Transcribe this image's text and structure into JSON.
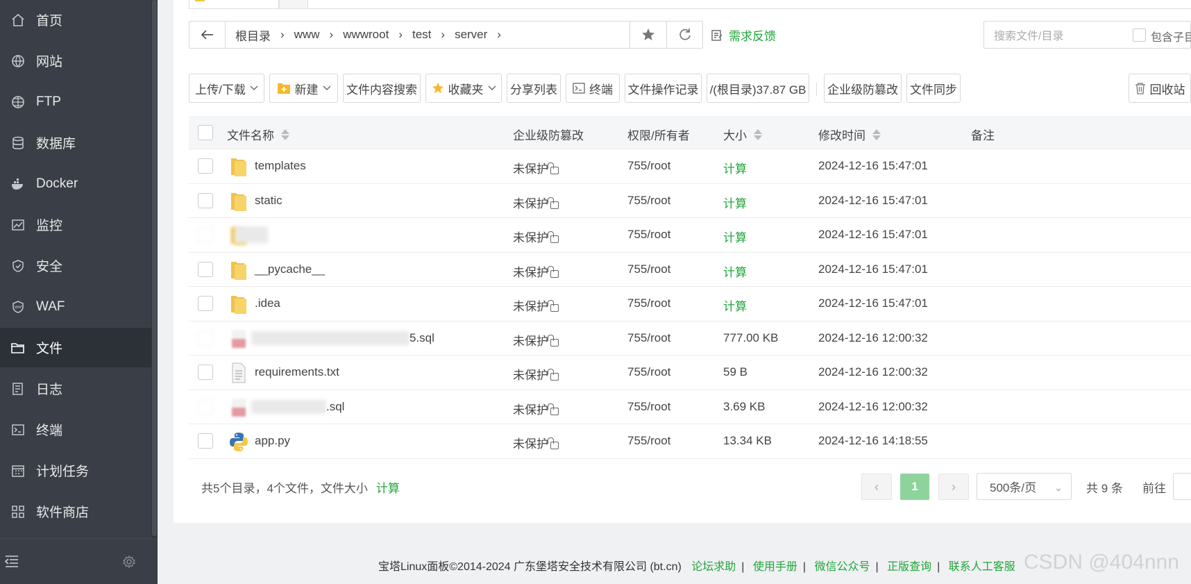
{
  "sidebar": {
    "items": [
      {
        "label": "首页",
        "icon": "home-icon"
      },
      {
        "label": "网站",
        "icon": "globe-icon"
      },
      {
        "label": "FTP",
        "icon": "ftp-globe-icon"
      },
      {
        "label": "数据库",
        "icon": "database-icon"
      },
      {
        "label": "Docker",
        "icon": "docker-icon"
      },
      {
        "label": "监控",
        "icon": "monitor-chart-icon"
      },
      {
        "label": "安全",
        "icon": "shield-icon"
      },
      {
        "label": "WAF",
        "icon": "waf-shield-icon"
      },
      {
        "label": "文件",
        "icon": "folder-icon"
      },
      {
        "label": "日志",
        "icon": "log-icon"
      },
      {
        "label": "终端",
        "icon": "terminal-icon"
      },
      {
        "label": "计划任务",
        "icon": "calendar-icon"
      },
      {
        "label": "软件商店",
        "icon": "app-grid-icon"
      }
    ],
    "active_index": 8
  },
  "pathbar": {
    "crumbs": [
      "根目录",
      "www",
      "wwwroot",
      "test",
      "server"
    ],
    "feedback": "需求反馈"
  },
  "search": {
    "placeholder": "搜索文件/目录",
    "include_sub": "包含子目"
  },
  "toolbar": {
    "upload": "上传/下载",
    "new": "新建",
    "content_search": "文件内容搜索",
    "favorites": "收藏夹",
    "share_list": "分享列表",
    "terminal": "终端",
    "op_log": "文件操作记录",
    "disk": "/(根目录)37.87 GB",
    "anti_tamper": "企业级防篡改",
    "sync": "文件同步",
    "recycle": "回收站"
  },
  "table": {
    "headers": {
      "name": "文件名称",
      "tamper": "企业级防篡改",
      "perm": "权限/所有者",
      "size": "大小",
      "mtime": "修改时间",
      "note": "备注"
    },
    "rows": [
      {
        "name": "templates",
        "type": "folder",
        "tamper": "未保护",
        "perm": "755/root",
        "size": "计算",
        "size_green": true,
        "mtime": "2024-12-16 15:47:01"
      },
      {
        "name": "static",
        "type": "folder",
        "tamper": "未保护",
        "perm": "755/root",
        "size": "计算",
        "size_green": true,
        "mtime": "2024-12-16 15:47:01"
      },
      {
        "name": "",
        "type": "folder-blurred",
        "tamper": "未保护",
        "perm": "755/root",
        "size": "计算",
        "size_green": true,
        "mtime": "2024-12-16 15:47:01"
      },
      {
        "name": "__pycache__",
        "type": "folder",
        "tamper": "未保护",
        "perm": "755/root",
        "size": "计算",
        "size_green": true,
        "mtime": "2024-12-16 15:47:01"
      },
      {
        "name": ".idea",
        "type": "folder",
        "tamper": "未保护",
        "perm": "755/root",
        "size": "计算",
        "size_green": true,
        "mtime": "2024-12-16 15:47:01"
      },
      {
        "name": "5.sql",
        "type": "sql-blurred",
        "tamper": "未保护",
        "perm": "755/root",
        "size": "777.00 KB",
        "size_green": false,
        "mtime": "2024-12-16 12:00:32"
      },
      {
        "name": "requirements.txt",
        "type": "txt",
        "tamper": "未保护",
        "perm": "755/root",
        "size": "59 B",
        "size_green": false,
        "mtime": "2024-12-16 12:00:32"
      },
      {
        "name": ".sql",
        "type": "sql-blurred",
        "tamper": "未保护",
        "perm": "755/root",
        "size": "3.69 KB",
        "size_green": false,
        "mtime": "2024-12-16 12:00:32"
      },
      {
        "name": "app.py",
        "type": "python",
        "tamper": "未保护",
        "perm": "755/root",
        "size": "13.34 KB",
        "size_green": false,
        "mtime": "2024-12-16 14:18:55"
      }
    ]
  },
  "summary": {
    "text": "共5个目录，4个文件，文件大小",
    "calc": "计算"
  },
  "pagination": {
    "current": "1",
    "per_page": "500条/页",
    "total": "共 9 条",
    "goto": "前往"
  },
  "footer": {
    "copyright": "宝塔Linux面板©2014-2024 广东堡塔安全技术有限公司 (bt.cn)",
    "links": [
      "论坛求助",
      "使用手册",
      "微信公众号",
      "正版查询",
      "联系人工客服"
    ]
  },
  "watermark": "CSDN @404nnn",
  "colors": {
    "accent": "#20a53a",
    "sidebar_bg": "#3a3f47",
    "sidebar_active": "#2c3037"
  }
}
